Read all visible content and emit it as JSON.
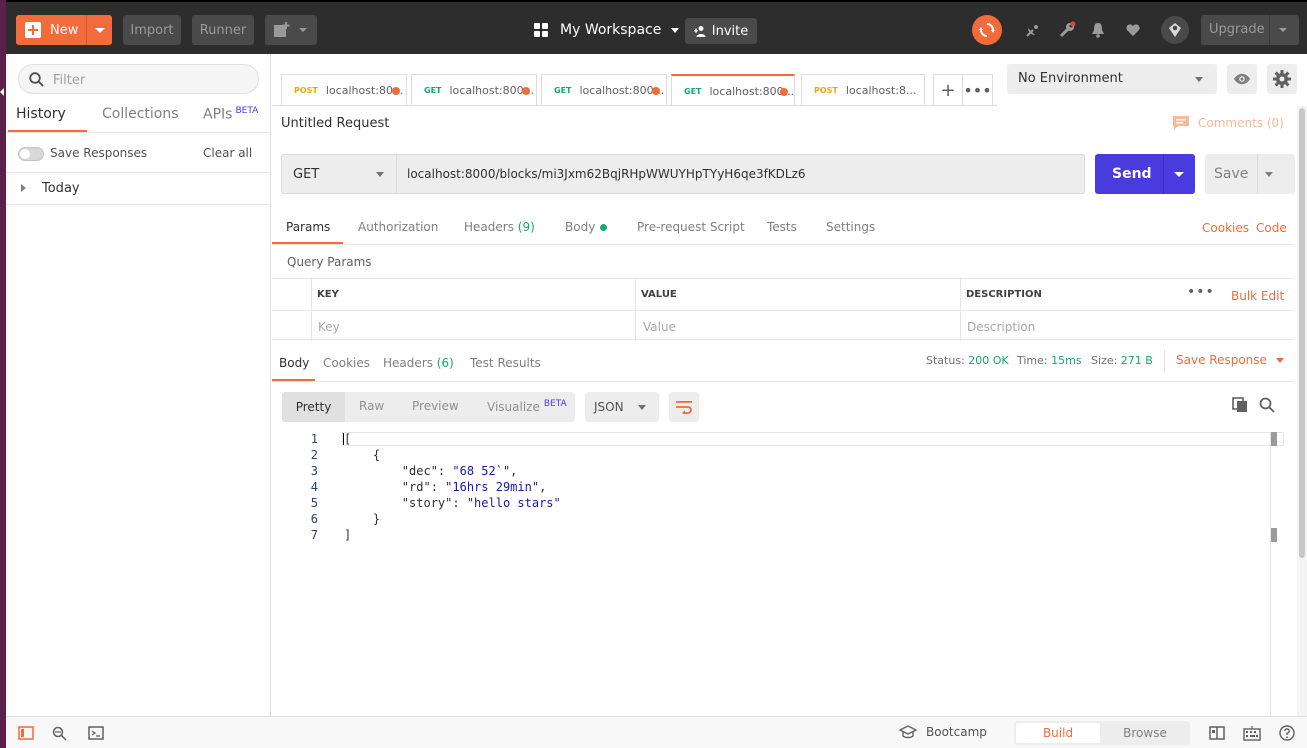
{
  "header": {
    "new_label": "New",
    "import_label": "Import",
    "runner_label": "Runner",
    "workspace_label": "My Workspace",
    "invite_label": "Invite",
    "upgrade_label": "Upgrade",
    "accent": "#f26b3a"
  },
  "sidebar": {
    "filter_placeholder": "Filter",
    "tabs": [
      {
        "label": "History",
        "active": true
      },
      {
        "label": "Collections",
        "active": false
      },
      {
        "label": "APIs",
        "badge": "BETA",
        "active": false
      }
    ],
    "save_responses_label": "Save Responses",
    "clear_all_label": "Clear all",
    "groups": [
      {
        "label": "Today"
      }
    ]
  },
  "request_tabs": [
    {
      "method": "POST",
      "label": "localhost:80...",
      "unsaved": true,
      "active": false
    },
    {
      "method": "GET",
      "label": "localhost:800...",
      "unsaved": true,
      "active": false
    },
    {
      "method": "GET",
      "label": "localhost:800...",
      "unsaved": true,
      "active": false
    },
    {
      "method": "GET",
      "label": "localhost:800...",
      "unsaved": true,
      "active": true
    },
    {
      "method": "POST",
      "label": "localhost:8...",
      "unsaved": false,
      "active": false
    }
  ],
  "environment": {
    "selected": "No Environment"
  },
  "request": {
    "title": "Untitled Request",
    "comments_label": "Comments (0)",
    "method": "GET",
    "url": "localhost:8000/blocks/mi3Jxm62BqjRHpWWUYHpTYyH6qe3fKDLz6",
    "send_label": "Send",
    "save_label": "Save"
  },
  "params_tabs": [
    {
      "label": "Params",
      "active": true
    },
    {
      "label": "Authorization"
    },
    {
      "label": "Headers",
      "count": "(9)"
    },
    {
      "label": "Body",
      "dot": true
    },
    {
      "label": "Pre-request Script"
    },
    {
      "label": "Tests"
    },
    {
      "label": "Settings"
    }
  ],
  "links": {
    "cookies": "Cookies",
    "code": "Code"
  },
  "query_params": {
    "title": "Query Params",
    "columns": [
      "KEY",
      "VALUE",
      "DESCRIPTION"
    ],
    "placeholders": [
      "Key",
      "Value",
      "Description"
    ],
    "bulk_edit": "Bulk Edit"
  },
  "response": {
    "tabs": [
      {
        "label": "Body",
        "active": true
      },
      {
        "label": "Cookies"
      },
      {
        "label": "Headers",
        "count": "(6)"
      },
      {
        "label": "Test Results"
      }
    ],
    "status_label": "Status:",
    "status_value": "200 OK",
    "time_label": "Time:",
    "time_value": "15ms",
    "size_label": "Size:",
    "size_value": "271 B",
    "save_response_label": "Save Response",
    "view_modes": [
      {
        "label": "Pretty",
        "active": true
      },
      {
        "label": "Raw"
      },
      {
        "label": "Preview"
      },
      {
        "label": "Visualize",
        "badge": "BETA"
      }
    ],
    "language": "JSON",
    "lines": [
      {
        "n": "1",
        "text": "["
      },
      {
        "n": "2",
        "text": "    {"
      },
      {
        "n": "3",
        "key": "\"dec\"",
        "value": "\"68 52`\"",
        "indent": "        ",
        "comma": ","
      },
      {
        "n": "4",
        "key": "\"rd\"",
        "value": "\"16hrs 29min\"",
        "indent": "        ",
        "comma": ","
      },
      {
        "n": "5",
        "key": "\"story\"",
        "value": "\"hello stars\"",
        "indent": "        ",
        "comma": ""
      },
      {
        "n": "6",
        "text": "    }"
      },
      {
        "n": "7",
        "text": "]"
      }
    ]
  },
  "footer": {
    "bootcamp_label": "Bootcamp",
    "build_label": "Build",
    "browse_label": "Browse"
  }
}
